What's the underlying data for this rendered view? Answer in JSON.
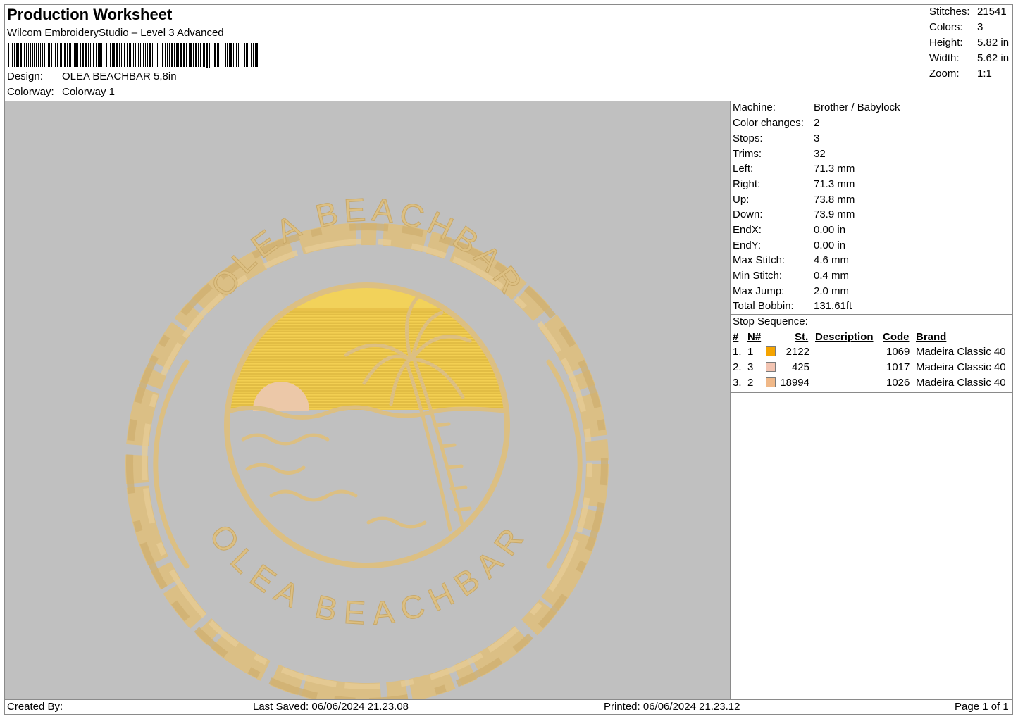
{
  "header": {
    "title": "Production Worksheet",
    "subtitle": "Wilcom EmbroideryStudio – Level 3 Advanced",
    "design_label": "Design:",
    "design_value": "OLEA BEACHBAR 5,8in",
    "colorway_label": "Colorway:",
    "colorway_value": "Colorway 1"
  },
  "stats": [
    {
      "label": "Stitches:",
      "value": "21541"
    },
    {
      "label": "Colors:",
      "value": "3"
    },
    {
      "label": "Height:",
      "value": "5.82 in"
    },
    {
      "label": "Width:",
      "value": "5.62 in"
    },
    {
      "label": "Zoom:",
      "value": "1:1"
    }
  ],
  "machine_info": [
    {
      "label": "Machine:",
      "value": "Brother / Babylock"
    },
    {
      "label": "Color changes:",
      "value": "2"
    },
    {
      "label": "Stops:",
      "value": "3"
    },
    {
      "label": "Trims:",
      "value": "32"
    },
    {
      "label": "Left:",
      "value": "71.3 mm"
    },
    {
      "label": "Right:",
      "value": "71.3 mm"
    },
    {
      "label": "Up:",
      "value": "73.8 mm"
    },
    {
      "label": "Down:",
      "value": "73.9 mm"
    },
    {
      "label": "EndX:",
      "value": "0.00 in"
    },
    {
      "label": "EndY:",
      "value": "0.00 in"
    },
    {
      "label": "Max Stitch:",
      "value": "4.6 mm"
    },
    {
      "label": "Min Stitch:",
      "value": "0.4 mm"
    },
    {
      "label": "Max Jump:",
      "value": "2.0 mm"
    },
    {
      "label": "Total Bobbin:",
      "value": "131.61ft"
    }
  ],
  "stop_sequence": {
    "title": "Stop Sequence:",
    "headers": {
      "num": "#",
      "n": "N#",
      "st": "St.",
      "desc": "Description",
      "code": "Code",
      "brand": "Brand"
    },
    "rows": [
      {
        "num": "1.",
        "n": "1",
        "color": "#f5a400",
        "st": "2122",
        "desc": "",
        "code": "1069",
        "brand": "Madeira Classic 40"
      },
      {
        "num": "2.",
        "n": "3",
        "color": "#f2c4b2",
        "st": "425",
        "desc": "",
        "code": "1017",
        "brand": "Madeira Classic 40"
      },
      {
        "num": "3.",
        "n": "2",
        "color": "#f0b888",
        "st": "18994",
        "desc": "",
        "code": "1026",
        "brand": "Madeira Classic 40"
      }
    ]
  },
  "design": {
    "text_top": "OLEA BEACHBAR",
    "text_bottom": "OLEA BEACHBAR",
    "thread_color": "#dcbf82",
    "sky_color": "#f0c840",
    "sun_color": "#ecc8a8",
    "background": "#c0c0c0"
  },
  "footer": {
    "created_by": "Created By:",
    "last_saved": "Last Saved: 06/06/2024 21.23.08",
    "printed": "Printed: 06/06/2024 21.23.12",
    "page": "Page 1 of 1"
  }
}
